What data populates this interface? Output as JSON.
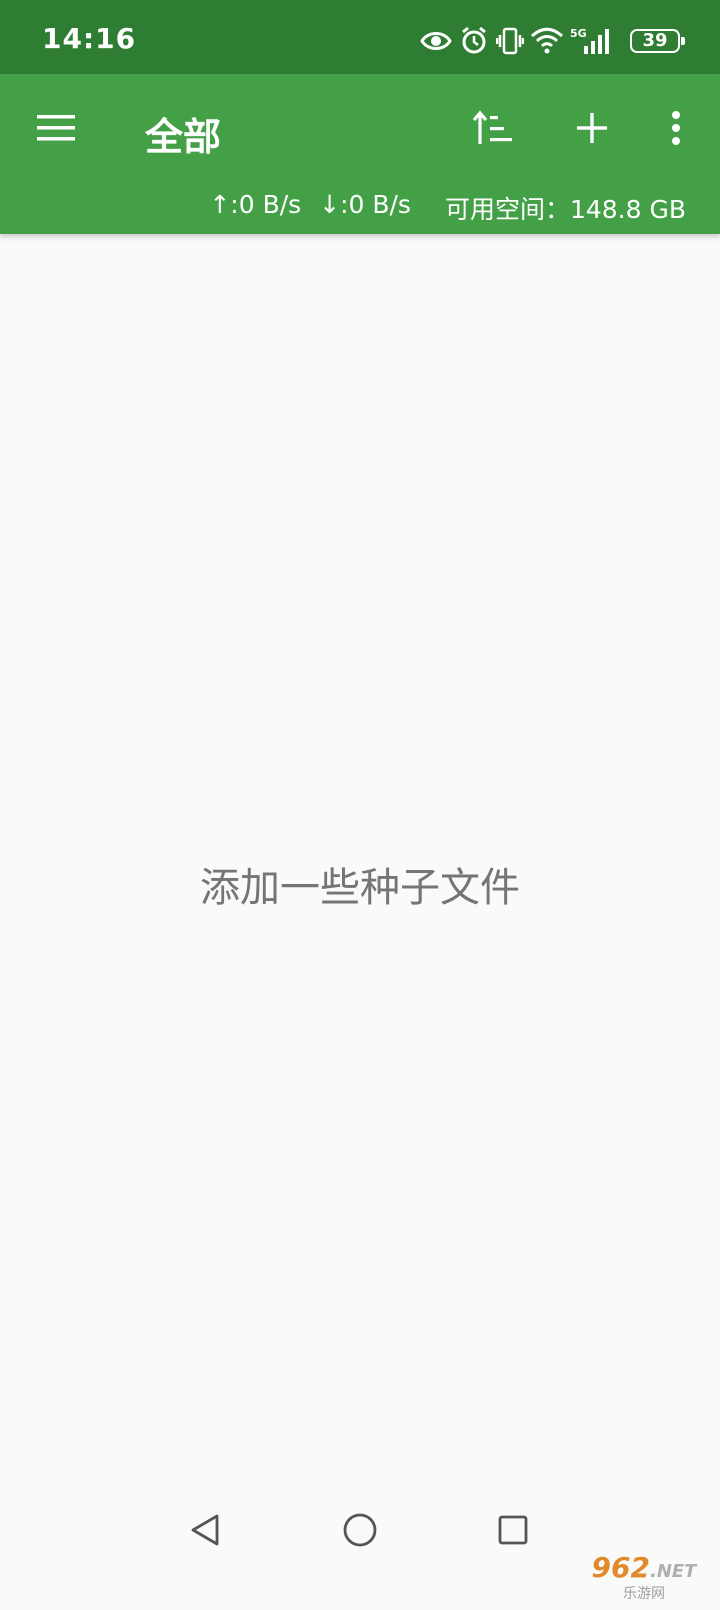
{
  "status_bar": {
    "time": "14:16",
    "battery": "39",
    "network": "5G",
    "icons": [
      "eye-icon",
      "alarm-icon",
      "vibrate-icon",
      "wifi-icon",
      "signal-icon",
      "battery-icon"
    ]
  },
  "toolbar": {
    "title": "全部",
    "actions": [
      "sort-icon",
      "add-icon",
      "more-vert-icon"
    ],
    "upload_speed": "↑:0 B/s",
    "download_speed": "↓:0 B/s",
    "free_space": "可用空间：148.8 GB"
  },
  "main": {
    "empty_message": "添加一些种子文件"
  },
  "watermark": {
    "logo": "962",
    "suffix": ".NET",
    "sub": "乐游网"
  },
  "colors": {
    "status_bar": "#2e7d32",
    "toolbar": "#43a047",
    "background": "#fafafa",
    "empty_text": "#757575"
  }
}
